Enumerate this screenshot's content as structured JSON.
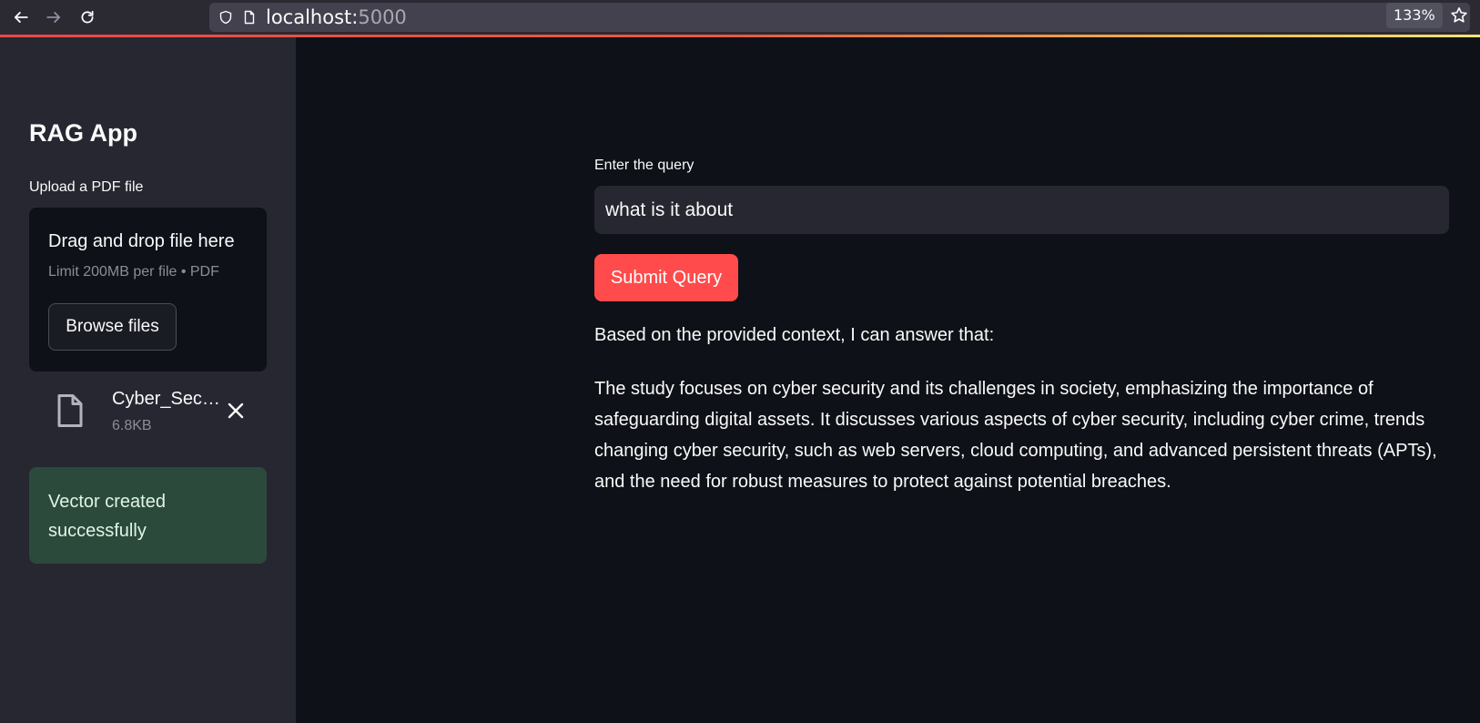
{
  "browser": {
    "url_host": "localhost:",
    "url_port": "5000",
    "zoom": "133%"
  },
  "sidebar": {
    "title": "RAG App",
    "upload_label": "Upload a PDF file",
    "dropzone": {
      "title": "Drag and drop file here",
      "subtitle": "Limit 200MB per file • PDF",
      "browse_label": "Browse files"
    },
    "file": {
      "name": "Cyber_Sec…",
      "size": "6.8KB",
      "icon": "file-icon"
    },
    "success_message": "Vector created successfully"
  },
  "main": {
    "query_label": "Enter the query",
    "query_value": "what is it about",
    "submit_label": "Submit Query",
    "answer_intro": "Based on the provided context, I can answer that:",
    "answer_body": "The study focuses on cyber security and its challenges in society, emphasizing the importance of safeguarding digital assets. It discusses various aspects of cyber security, including cyber crime, trends changing cyber security, such as web servers, cloud computing, and advanced persistent threats (APTs), and the need for robust measures to protect against potential breaches."
  },
  "colors": {
    "primary_button": "#ff4b4b",
    "sidebar_bg": "#262730",
    "main_bg": "#0e1117",
    "success_bg": "#2c4a3b"
  }
}
